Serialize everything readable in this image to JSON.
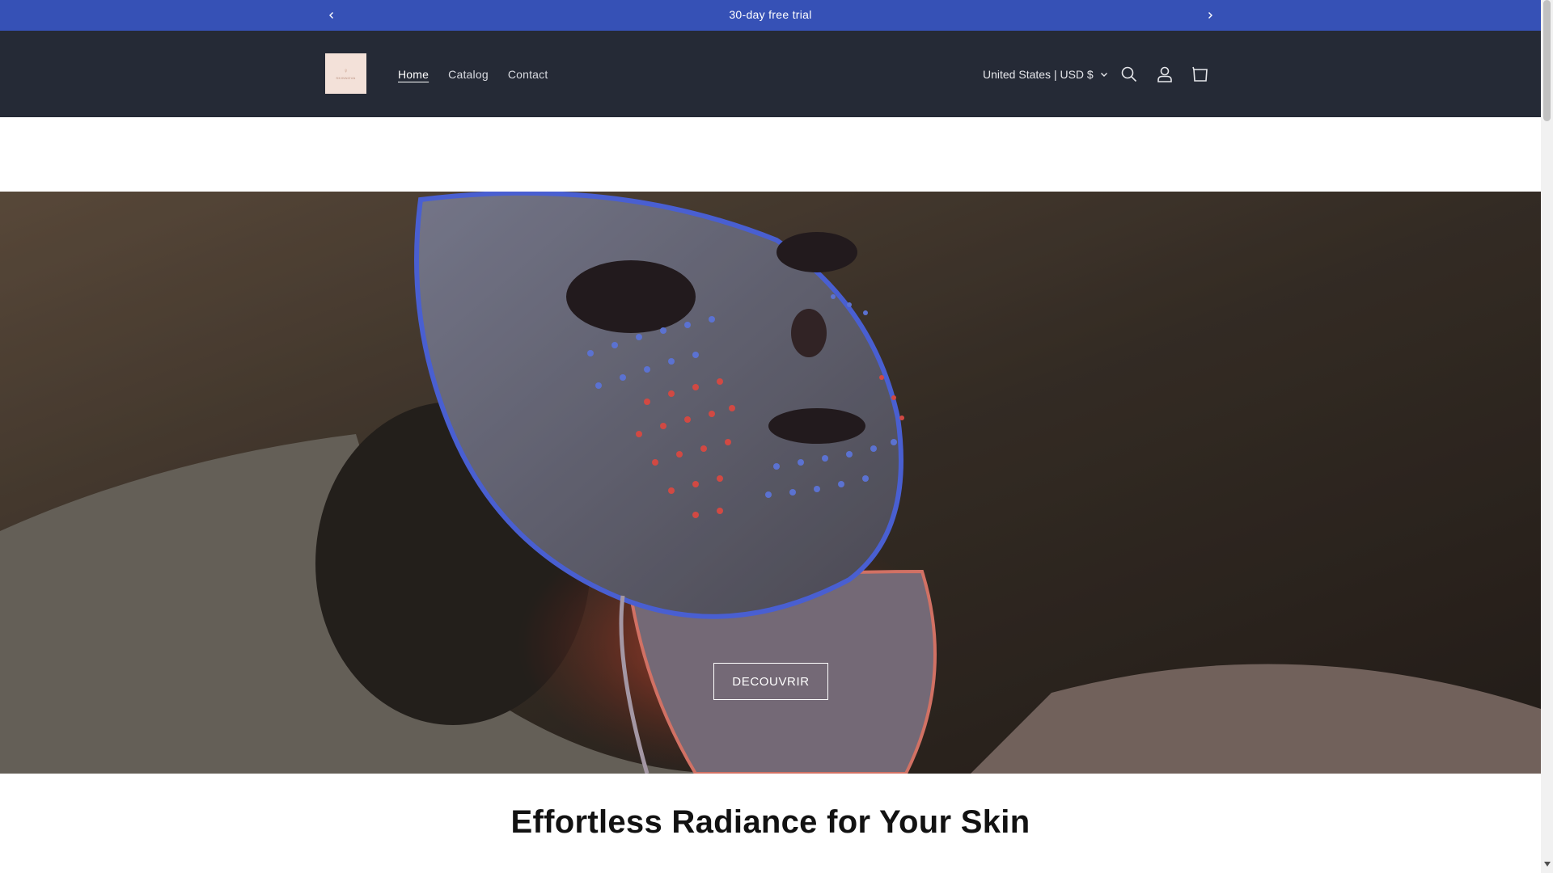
{
  "announcement": {
    "text": "30-day free trial",
    "prev_icon": "chevron-left-icon",
    "next_icon": "chevron-right-icon"
  },
  "header": {
    "logo_text": "SKINNOVA",
    "nav": [
      {
        "label": "Home",
        "active": true
      },
      {
        "label": "Catalog",
        "active": false
      },
      {
        "label": "Contact",
        "active": false
      }
    ],
    "locale": "United States | USD $",
    "icons": [
      "search-icon",
      "account-icon",
      "cart-icon"
    ]
  },
  "hero": {
    "cta_label": "DECOUVRIR"
  },
  "section": {
    "title": "Effortless Radiance for Your Skin"
  },
  "colors": {
    "announcement_bg": "#3651b6",
    "header_bg": "#252a36",
    "text_dark": "#121212",
    "logo_bg": "#f3e1d9"
  }
}
